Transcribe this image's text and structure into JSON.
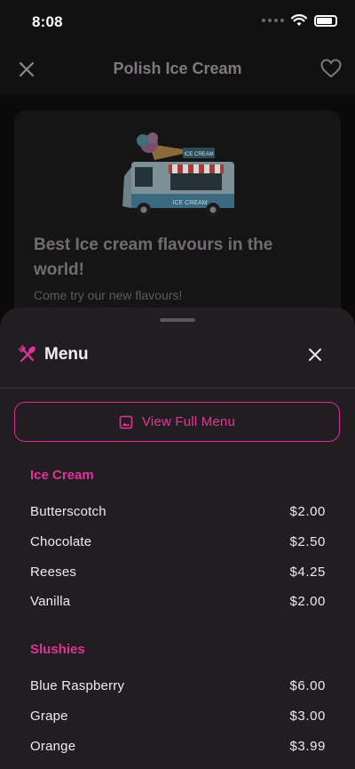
{
  "status_bar": {
    "time": "8:08"
  },
  "navbar": {
    "title": "Polish Ice Cream"
  },
  "card": {
    "headline": "Best Ice cream flavours in the world!",
    "subtitle": "Come try our new flavours!",
    "truck_sign_top": "ICE CREAM",
    "truck_sign_side": "ICE CREAM"
  },
  "sheet": {
    "title": "Menu",
    "full_menu_label": "View Full Menu",
    "accent": "#e0339a",
    "sections": [
      {
        "name": "Ice Cream",
        "items": [
          {
            "name": "Butterscotch",
            "price": "$2.00"
          },
          {
            "name": "Chocolate",
            "price": "$2.50"
          },
          {
            "name": "Reeses",
            "price": "$4.25"
          },
          {
            "name": "Vanilla",
            "price": "$2.00"
          }
        ]
      },
      {
        "name": "Slushies",
        "items": [
          {
            "name": "Blue Raspberry",
            "price": "$6.00"
          },
          {
            "name": "Grape",
            "price": "$3.00"
          },
          {
            "name": "Orange",
            "price": "$3.99"
          }
        ]
      }
    ]
  },
  "icons": [
    "close-icon",
    "heart-icon",
    "wifi-icon",
    "battery-icon",
    "utensils-icon",
    "image-icon"
  ]
}
